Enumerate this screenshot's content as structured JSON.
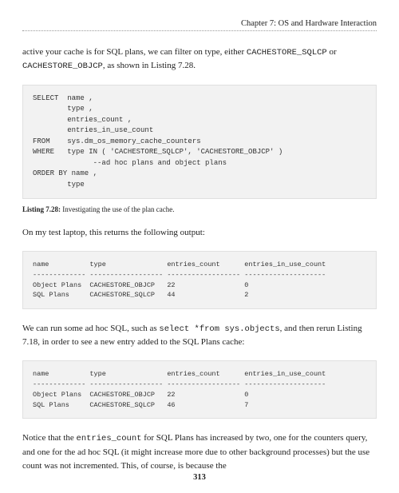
{
  "header": {
    "chapter": "Chapter 7: OS and Hardware Interaction"
  },
  "para1_pre": "active your cache is for SQL plans, we can filter on type, either ",
  "para1_code1": "CACHESTORE_SQLCP",
  "para1_mid": " or ",
  "para1_code2": "CACHESTORE_OBJCP",
  "para1_post": ", as shown in Listing 7.28.",
  "code1": "SELECT  name ,\n        type ,\n        entries_count ,\n        entries_in_use_count\nFROM    sys.dm_os_memory_cache_counters\nWHERE   type IN ( 'CACHESTORE_SQLCP', 'CACHESTORE_OBJCP' )\n              --ad hoc plans and object plans\nORDER BY name ,\n        type",
  "caption1_label": "Listing 7.28:",
  "caption1_text": "  Investigating the use of the plan cache.",
  "para2": "On my test laptop, this returns the following output:",
  "output1": "name          type               entries_count      entries_in_use_count\n------------- ------------------ ------------------ --------------------\nObject Plans  CACHESTORE_OBJCP   22                 0\nSQL Plans     CACHESTORE_SQLCP   44                 2",
  "para3_pre": "We can run some ad hoc SQL, such as ",
  "para3_code": "select *from sys.objects",
  "para3_post": ", and then rerun Listing 7.18, in order to see a new entry added to the SQL Plans cache:",
  "output2": "name          type               entries_count      entries_in_use_count\n------------- ------------------ ------------------ --------------------\nObject Plans  CACHESTORE_OBJCP   22                 0\nSQL Plans     CACHESTORE_SQLCP   46                 7",
  "para4_pre": "Notice that the ",
  "para4_code": "entries_count",
  "para4_post": " for SQL Plans has increased by two, one for the counters query, and one for the ad hoc SQL (it might increase more due to other background processes) but the use count was not incremented. This, of course, is because the",
  "page_number": "313"
}
